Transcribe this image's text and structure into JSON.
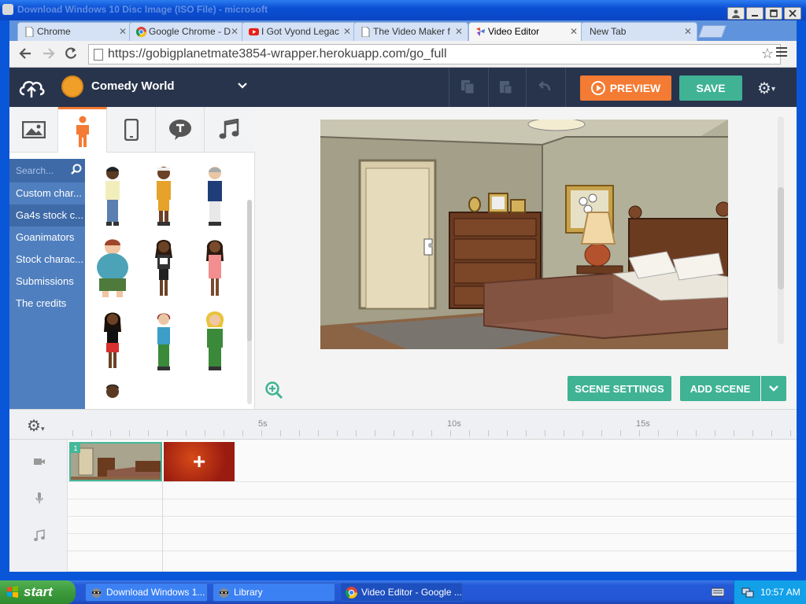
{
  "window": {
    "title": "Download Windows 10 Disc Image (ISO File) - microsoft"
  },
  "tabs": [
    {
      "label": "Chrome",
      "icon": "page-icon"
    },
    {
      "label": "Google Chrome - D",
      "icon": "chrome-icon"
    },
    {
      "label": "I Got Vyond Legac",
      "icon": "youtube-icon"
    },
    {
      "label": "The Video Maker f",
      "icon": "page-icon"
    },
    {
      "label": "Video Editor",
      "icon": "video-editor-icon"
    },
    {
      "label": "New Tab",
      "icon": ""
    }
  ],
  "address_bar": {
    "url": "https://gobigplanetmate3854-wrapper.herokuapp.com/go_full"
  },
  "app": {
    "theme_name": "Comedy World",
    "preview_label": "PREVIEW",
    "save_label": "SAVE",
    "accent_orange": "#f47b33",
    "accent_green": "#3fb394"
  },
  "library": {
    "search_placeholder": "Search...",
    "categories": [
      "Custom char...",
      "Ga4s stock c...",
      "Goanimators",
      "Stock charac...",
      "Submissions",
      "The credits"
    ]
  },
  "stage": {
    "scene_settings_label": "SCENE SETTINGS",
    "add_scene_label": "ADD SCENE"
  },
  "timeline": {
    "ticks": [
      "5s",
      "10s",
      "15s"
    ],
    "scene_number": "1",
    "add_symbol": "+"
  },
  "taskbar": {
    "start_label": "start",
    "tasks": [
      {
        "label": "Download Windows 1...",
        "icon": "raccoon-icon"
      },
      {
        "label": "Library",
        "icon": "raccoon-icon"
      },
      {
        "label": "Video Editor - Google ...",
        "icon": "chrome-icon"
      }
    ],
    "clock": "10:57 AM"
  }
}
